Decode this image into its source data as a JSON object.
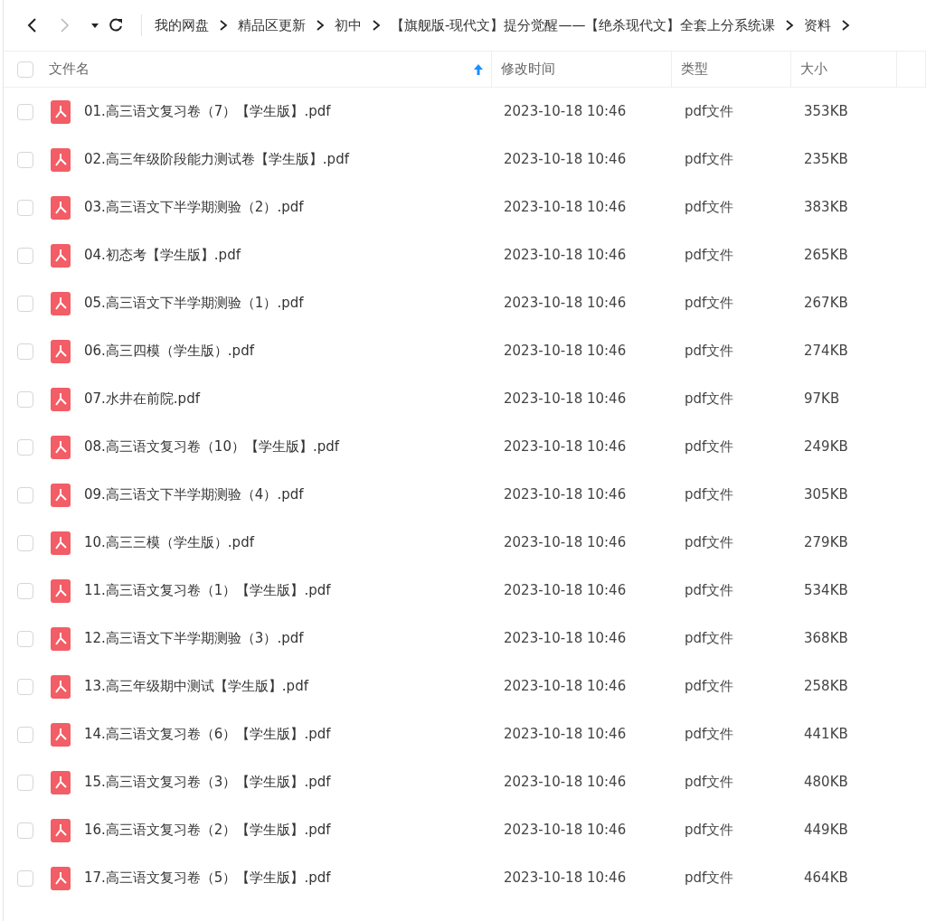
{
  "nav_buttons": [
    {
      "kind": "back",
      "disabled": false
    },
    {
      "kind": "forward",
      "disabled": true
    },
    {
      "kind": "dropdown",
      "disabled": false
    },
    {
      "kind": "refresh",
      "disabled": false
    }
  ],
  "breadcrumb": [
    "我的网盘",
    "精品区更新",
    "初中",
    "【旗舰版-现代文】提分觉醒——【绝杀现代文】全套上分系统课",
    "资料"
  ],
  "table": {
    "select_all_checked": false,
    "columns": [
      {
        "label": "文件名",
        "sorted": true
      },
      {
        "label": "修改时间",
        "sorted": false
      },
      {
        "label": "类型",
        "sorted": false
      },
      {
        "label": "大小",
        "sorted": false
      }
    ],
    "rows": [
      {
        "name": "01.高三语文复习卷（7）【学生版】.pdf",
        "modified": "2023-10-18 10:46",
        "type": "pdf文件",
        "size": "353KB",
        "checked": false
      },
      {
        "name": "02.高三年级阶段能力测试卷【学生版】.pdf",
        "modified": "2023-10-18 10:46",
        "type": "pdf文件",
        "size": "235KB",
        "checked": false
      },
      {
        "name": "03.高三语文下半学期测验（2）.pdf",
        "modified": "2023-10-18 10:46",
        "type": "pdf文件",
        "size": "383KB",
        "checked": false
      },
      {
        "name": "04.初态考【学生版】.pdf",
        "modified": "2023-10-18 10:46",
        "type": "pdf文件",
        "size": "265KB",
        "checked": false
      },
      {
        "name": "05.高三语文下半学期测验（1）.pdf",
        "modified": "2023-10-18 10:46",
        "type": "pdf文件",
        "size": "267KB",
        "checked": false
      },
      {
        "name": "06.高三四模（学生版）.pdf",
        "modified": "2023-10-18 10:46",
        "type": "pdf文件",
        "size": "274KB",
        "checked": false
      },
      {
        "name": "07.水井在前院.pdf",
        "modified": "2023-10-18 10:46",
        "type": "pdf文件",
        "size": "97KB",
        "checked": false
      },
      {
        "name": "08.高三语文复习卷（10）【学生版】.pdf",
        "modified": "2023-10-18 10:46",
        "type": "pdf文件",
        "size": "249KB",
        "checked": false
      },
      {
        "name": "09.高三语文下半学期测验（4）.pdf",
        "modified": "2023-10-18 10:46",
        "type": "pdf文件",
        "size": "305KB",
        "checked": false
      },
      {
        "name": "10.高三三模（学生版）.pdf",
        "modified": "2023-10-18 10:46",
        "type": "pdf文件",
        "size": "279KB",
        "checked": false
      },
      {
        "name": "11.高三语文复习卷（1）【学生版】.pdf",
        "modified": "2023-10-18 10:46",
        "type": "pdf文件",
        "size": "534KB",
        "checked": false
      },
      {
        "name": "12.高三语文下半学期测验（3）.pdf",
        "modified": "2023-10-18 10:46",
        "type": "pdf文件",
        "size": "368KB",
        "checked": false
      },
      {
        "name": "13.高三年级期中测试【学生版】.pdf",
        "modified": "2023-10-18 10:46",
        "type": "pdf文件",
        "size": "258KB",
        "checked": false
      },
      {
        "name": "14.高三语文复习卷（6）【学生版】.pdf",
        "modified": "2023-10-18 10:46",
        "type": "pdf文件",
        "size": "441KB",
        "checked": false
      },
      {
        "name": "15.高三语文复习卷（3）【学生版】.pdf",
        "modified": "2023-10-18 10:46",
        "type": "pdf文件",
        "size": "480KB",
        "checked": false
      },
      {
        "name": "16.高三语文复习卷（2）【学生版】.pdf",
        "modified": "2023-10-18 10:46",
        "type": "pdf文件",
        "size": "449KB",
        "checked": false
      },
      {
        "name": "17.高三语文复习卷（5）【学生版】.pdf",
        "modified": "2023-10-18 10:46",
        "type": "pdf文件",
        "size": "464KB",
        "checked": false
      }
    ]
  }
}
